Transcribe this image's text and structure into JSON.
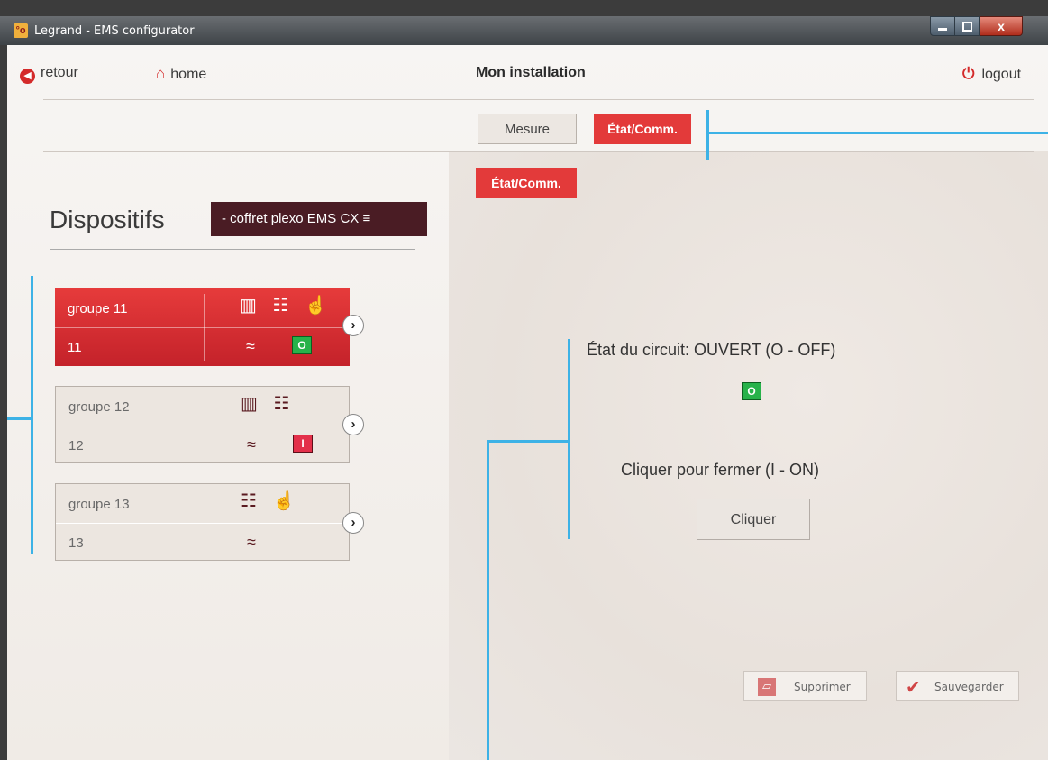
{
  "window": {
    "title": "Legrand - EMS configurator",
    "app_icon": "°o",
    "close_glyph": "x"
  },
  "nav": {
    "retour": "retour",
    "home": "home",
    "logout": "logout",
    "page_title": "Mon installation"
  },
  "tabs": {
    "mesure": "Mesure",
    "etat": "État/Comm.",
    "subtab": "État/Comm."
  },
  "left": {
    "heading": "Dispositifs",
    "selector": "- coffret plexo EMS CX ≡"
  },
  "cards": [
    {
      "name": "groupe 11",
      "num": "11",
      "state": "O",
      "active": true,
      "icons": "📊 🚦 👆"
    },
    {
      "name": "groupe 12",
      "num": "12",
      "state": "I",
      "active": false,
      "icons": "📊 🚦"
    },
    {
      "name": "groupe 13",
      "num": "13",
      "state": "",
      "active": false,
      "icons": "🚦 👆"
    }
  ],
  "status": {
    "etat_text": "État du circuit: OUVERT (O - OFF)",
    "badge": "O",
    "prompt": "Cliquer pour fermer (I - ON)",
    "button": "Cliquer"
  },
  "actions": {
    "supprimer": "Supprimer",
    "sauvegarder": "Sauvegarder"
  },
  "colors": {
    "accent": "#e33a3a",
    "dark_brand": "#4a1c24",
    "annotation": "#3db2e6",
    "on_green": "#27b24a"
  }
}
